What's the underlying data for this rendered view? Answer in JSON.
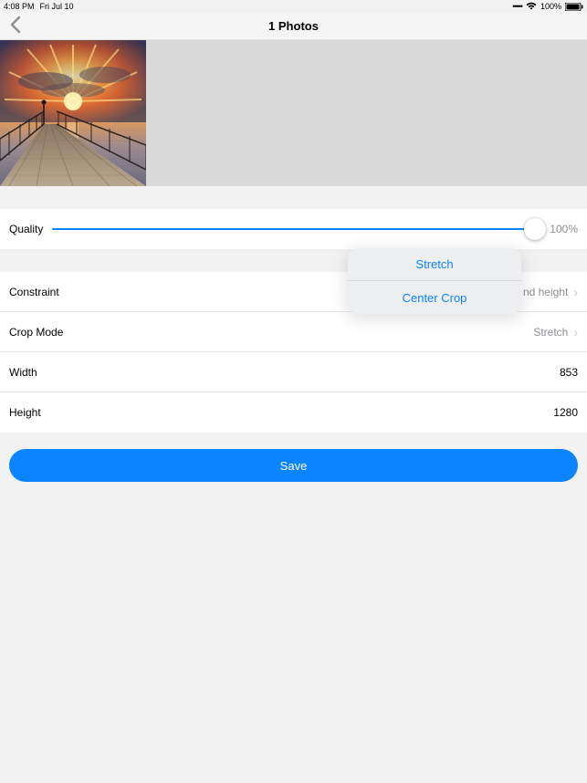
{
  "status": {
    "time": "4:08 PM",
    "date": "Fri Jul 10",
    "battery_pct": "100%"
  },
  "nav": {
    "title": "1 Photos"
  },
  "quality": {
    "label": "Quality",
    "pct": "100%"
  },
  "rows": {
    "constraint": {
      "label": "Constraint",
      "value": "nd height"
    },
    "crop_mode": {
      "label": "Crop Mode",
      "value": "Stretch"
    },
    "width": {
      "label": "Width",
      "value": "853"
    },
    "height": {
      "label": "Height",
      "value": "1280"
    }
  },
  "save_label": "Save",
  "popover": {
    "option1": "Stretch",
    "option2": "Center Crop"
  }
}
